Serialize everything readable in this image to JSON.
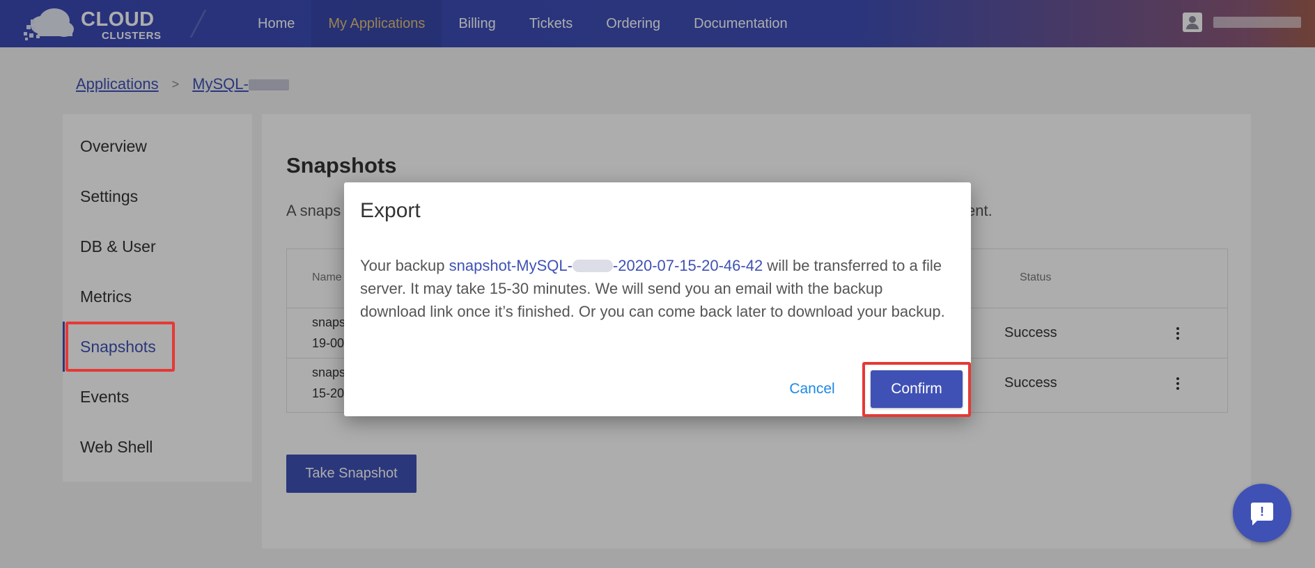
{
  "header": {
    "logo_line1": "CLOUD",
    "logo_line2": "CLUSTERS",
    "nav": [
      {
        "label": "Home"
      },
      {
        "label": "My Applications"
      },
      {
        "label": "Billing"
      },
      {
        "label": "Tickets"
      },
      {
        "label": "Ordering"
      },
      {
        "label": "Documentation"
      }
    ],
    "active_nav": "My Applications",
    "user_icon": "account-box-icon"
  },
  "breadcrumb": {
    "root": "Applications",
    "separator": ">",
    "current": "MySQL-"
  },
  "sidebar": {
    "items": [
      {
        "label": "Overview"
      },
      {
        "label": "Settings"
      },
      {
        "label": "DB & User"
      },
      {
        "label": "Metrics"
      },
      {
        "label": "Snapshots"
      },
      {
        "label": "Events"
      },
      {
        "label": "Web Shell"
      }
    ],
    "active": "Snapshots"
  },
  "main": {
    "title": "Snapshots",
    "description_start": "A snaps",
    "description_end": "ent.",
    "table": {
      "columns": [
        "Name",
        "Status"
      ],
      "rows": [
        {
          "name_line1": "snaps",
          "name_line2": "19-00",
          "status": "Success"
        },
        {
          "name_line1": "snaps",
          "name_line2": "15-20",
          "status": "Success"
        }
      ]
    },
    "take_snapshot_label": "Take Snapshot"
  },
  "dialog": {
    "title": "Export",
    "body_prefix": "Your backup ",
    "snapshot_name_start": "snapshot-MySQL-",
    "snapshot_name_end": "-2020-07-15-20-46-42",
    "body_suffix": " will be transferred to a file server. It may take 15-30 minutes. We will send you an email with the backup download link once it’s finished. Or you can come back later to download your backup.",
    "cancel_label": "Cancel",
    "confirm_label": "Confirm"
  },
  "fab": {
    "icon": "feedback-icon",
    "glyph": "!"
  },
  "colors": {
    "primary": "#3f51b5",
    "highlight": "#e53935",
    "active_nav": "#e3c27b",
    "cancel": "#1e88e5"
  }
}
